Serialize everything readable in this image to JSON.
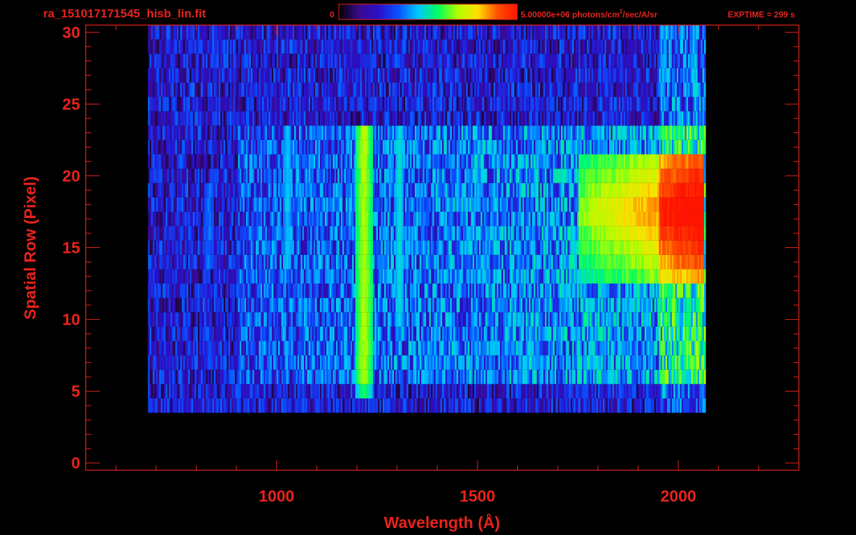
{
  "header": {
    "filename": "ra_151017171545_hisb_lin.fit",
    "colorbar_min_label": "0",
    "colorbar_max_label": "5.00000e+06 photons/cm",
    "colorbar_unit_exp": "2",
    "colorbar_unit_rest": "/sec/A/sr",
    "exptime": "EXPTIME = 299 s"
  },
  "colors": {
    "axis": "#e8231c",
    "background": "#000000"
  },
  "chart_data": {
    "type": "heatmap",
    "xlabel": "Wavelength (Å)",
    "ylabel": "Spatial Row (Pixel)",
    "xlim": [
      525,
      2300
    ],
    "ylim": [
      -0.5,
      30.5
    ],
    "xticks": [
      1000,
      1500,
      2000
    ],
    "yticks": [
      0,
      5,
      10,
      15,
      20,
      25,
      30
    ],
    "colorscale": [
      "#000000",
      "#3a0a8a",
      "#2a10c8",
      "#0a50ff",
      "#00c8ff",
      "#00ff60",
      "#b0ff00",
      "#ffe000",
      "#ff5000",
      "#ff1400"
    ],
    "zlim": [
      0,
      5000000
    ],
    "data_extent": {
      "x": [
        680,
        2065
      ],
      "rows_min": 4,
      "rows_max": 30
    },
    "features": [
      {
        "wavelength": 1216,
        "rows": [
          5,
          23
        ],
        "peak_fraction": 0.55,
        "width": 22
      },
      {
        "wavelength": 1025,
        "rows": [
          14,
          23
        ],
        "peak_fraction": 0.35,
        "width": 10
      },
      {
        "wavelength": 1304,
        "rows": [
          10,
          23
        ],
        "peak_fraction": 0.35,
        "width": 10
      },
      {
        "wavelength": 830,
        "rows": [
          14,
          19
        ],
        "peak_fraction": 0.35,
        "width": 14
      },
      {
        "continuum": [
          1750,
          2060
        ],
        "rows": [
          13,
          21
        ],
        "peak_fraction": 0.75
      }
    ]
  }
}
